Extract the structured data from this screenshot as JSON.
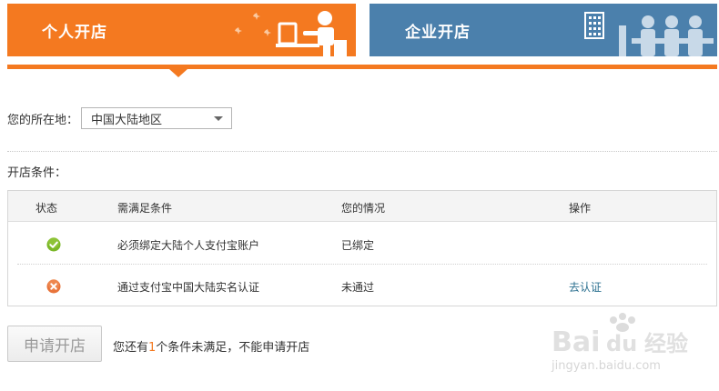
{
  "tabs": {
    "personal": {
      "label": "个人开店"
    },
    "business": {
      "label": "企业开店"
    }
  },
  "location": {
    "label": "您的所在地：",
    "selected": "中国大陆地区"
  },
  "conditions": {
    "title": "开店条件：",
    "headers": {
      "status": "状态",
      "requirement": "需满足条件",
      "situation": "您的情况",
      "action": "操作"
    },
    "rows": [
      {
        "status_icon": "check-circle-icon",
        "requirement": "必须绑定大陆个人支付宝账户",
        "situation": "已绑定",
        "action": ""
      },
      {
        "status_icon": "x-circle-icon",
        "requirement": "通过支付宝中国大陆实名认证",
        "situation": "未通过",
        "action": "去认证"
      }
    ]
  },
  "apply": {
    "button_label": "申请开店",
    "notice_prefix": "您还有",
    "notice_count": "1",
    "notice_suffix": "个条件未满足，不能申请开店"
  },
  "watermark": {
    "brand_left": "Bai",
    "brand_right": "du",
    "brand_cn": "经验",
    "url": "jingyan.baidu.com"
  },
  "colors": {
    "orange": "#f47920",
    "blue": "#4b80ac",
    "success": "#7ab727",
    "error": "#e8743b",
    "link": "#2a6f8f"
  }
}
